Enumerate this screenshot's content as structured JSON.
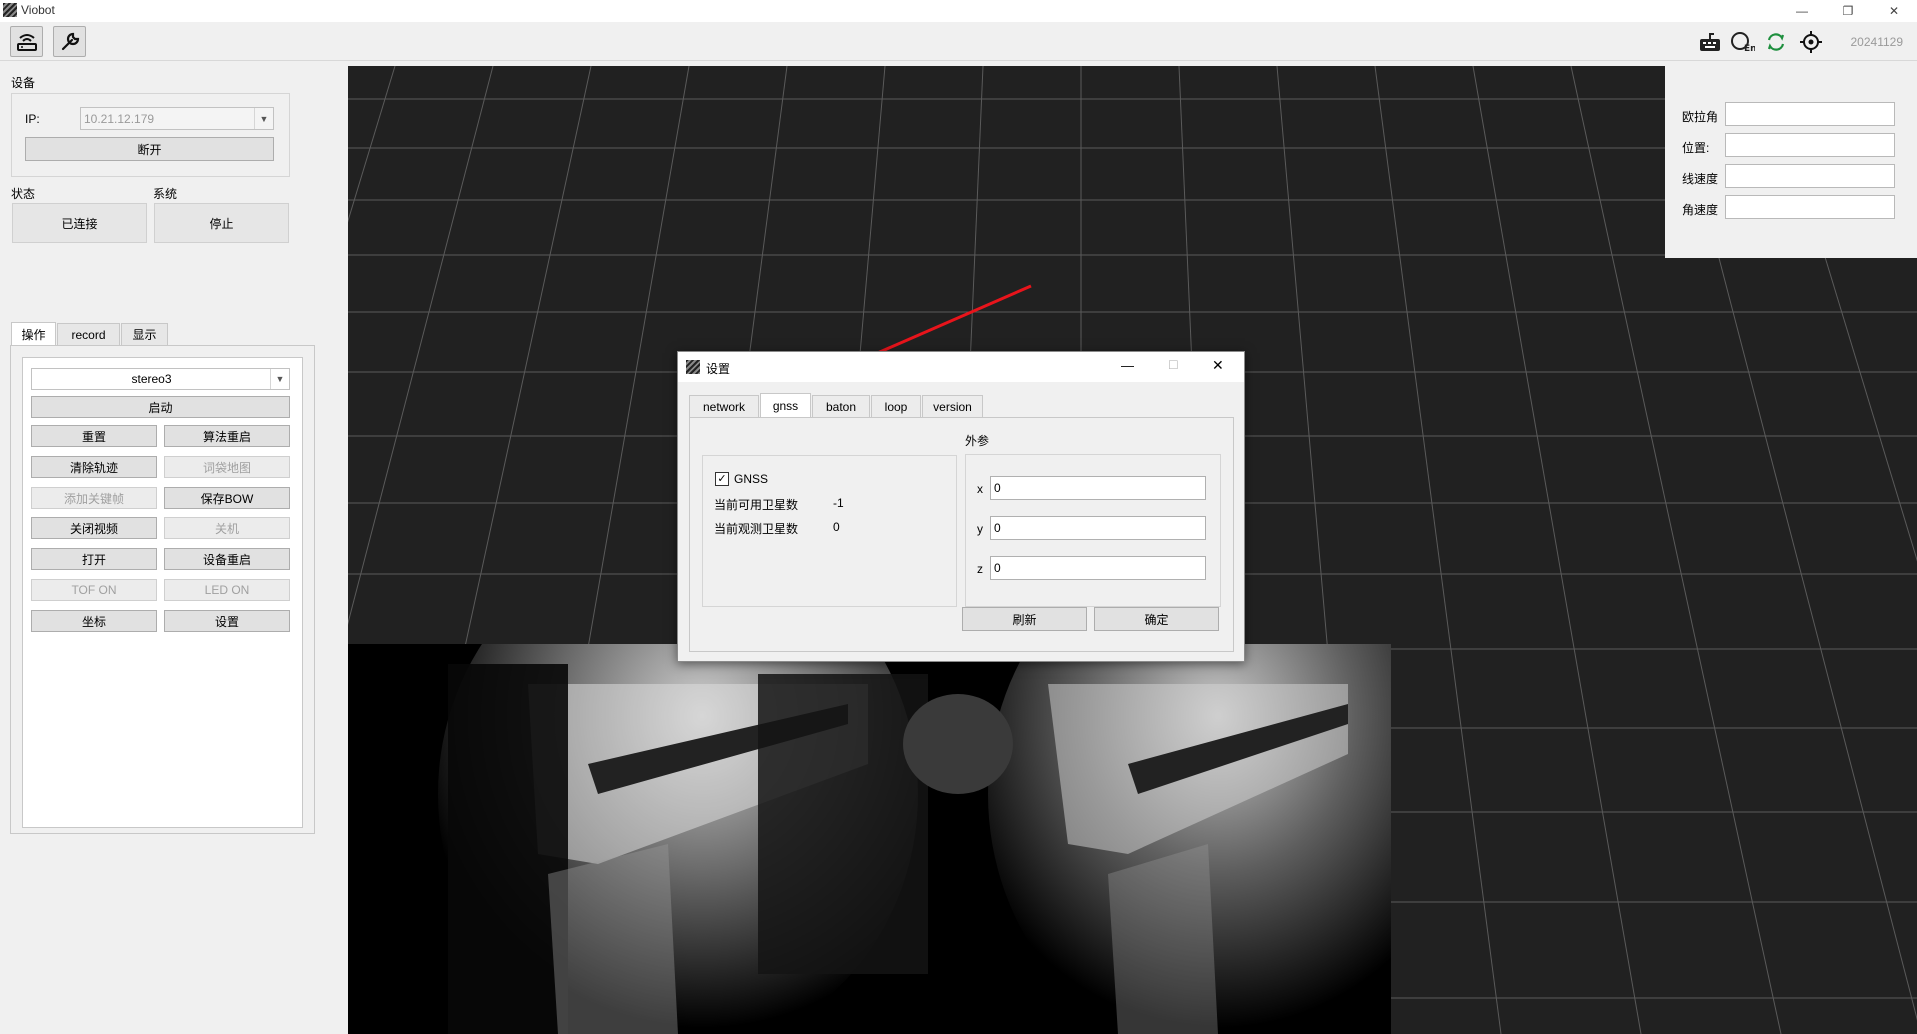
{
  "window": {
    "title": "Viobot",
    "build_version": "20241129"
  },
  "toolbar": {
    "left_icons": [
      "router-icon",
      "wrench-icon"
    ],
    "right_icons": [
      "keyboard-icon",
      "language-icon",
      "refresh-icon",
      "crosshair-icon"
    ]
  },
  "device": {
    "section_label": "设备",
    "ip_label": "IP:",
    "ip_value": "10.21.12.179",
    "disconnect_label": "断开",
    "status_label": "状态",
    "system_label": "系统",
    "status_value": "已连接",
    "system_value": "停止"
  },
  "left_tabs": [
    "操作",
    "record",
    "显示"
  ],
  "operations": {
    "mode_value": "stereo3",
    "start_label": "启动",
    "buttons": [
      {
        "label": "重置",
        "enabled": true
      },
      {
        "label": "算法重启",
        "enabled": true
      },
      {
        "label": "清除轨迹",
        "enabled": true
      },
      {
        "label": "词袋地图",
        "enabled": false
      },
      {
        "label": "添加关键帧",
        "enabled": false
      },
      {
        "label": "保存BOW",
        "enabled": true
      },
      {
        "label": "关闭视频",
        "enabled": true
      },
      {
        "label": "关机",
        "enabled": false
      },
      {
        "label": "打开",
        "enabled": true
      },
      {
        "label": "设备重启",
        "enabled": true
      },
      {
        "label": "TOF ON",
        "enabled": false
      },
      {
        "label": "LED ON",
        "enabled": false
      },
      {
        "label": "坐标",
        "enabled": true
      },
      {
        "label": "设置",
        "enabled": true
      }
    ]
  },
  "pose_panel": {
    "euler_label": "欧拉角",
    "position_label": "位置:",
    "linear_velocity_label": "线速度",
    "angular_velocity_label": "角速度"
  },
  "settings_dialog": {
    "title": "设置",
    "tabs": [
      "network",
      "gnss",
      "baton",
      "loop",
      "version"
    ],
    "active_tab": "gnss",
    "gnss_checkbox_label": "GNSS",
    "gnss_checked": true,
    "available_sats_label": "当前可用卫星数",
    "available_sats_value": "-1",
    "observed_sats_label": "当前观测卫星数",
    "observed_sats_value": "0",
    "extrinsics_label": "外参",
    "x_label": "x",
    "x_value": "0",
    "y_label": "y",
    "y_value": "0",
    "z_label": "z",
    "z_value": "0",
    "refresh_label": "刷新",
    "ok_label": "确定"
  },
  "colors": {
    "viewer_bg": "#212121",
    "grid": "#5a5a5a",
    "annotation_arrow": "#e8141b"
  }
}
